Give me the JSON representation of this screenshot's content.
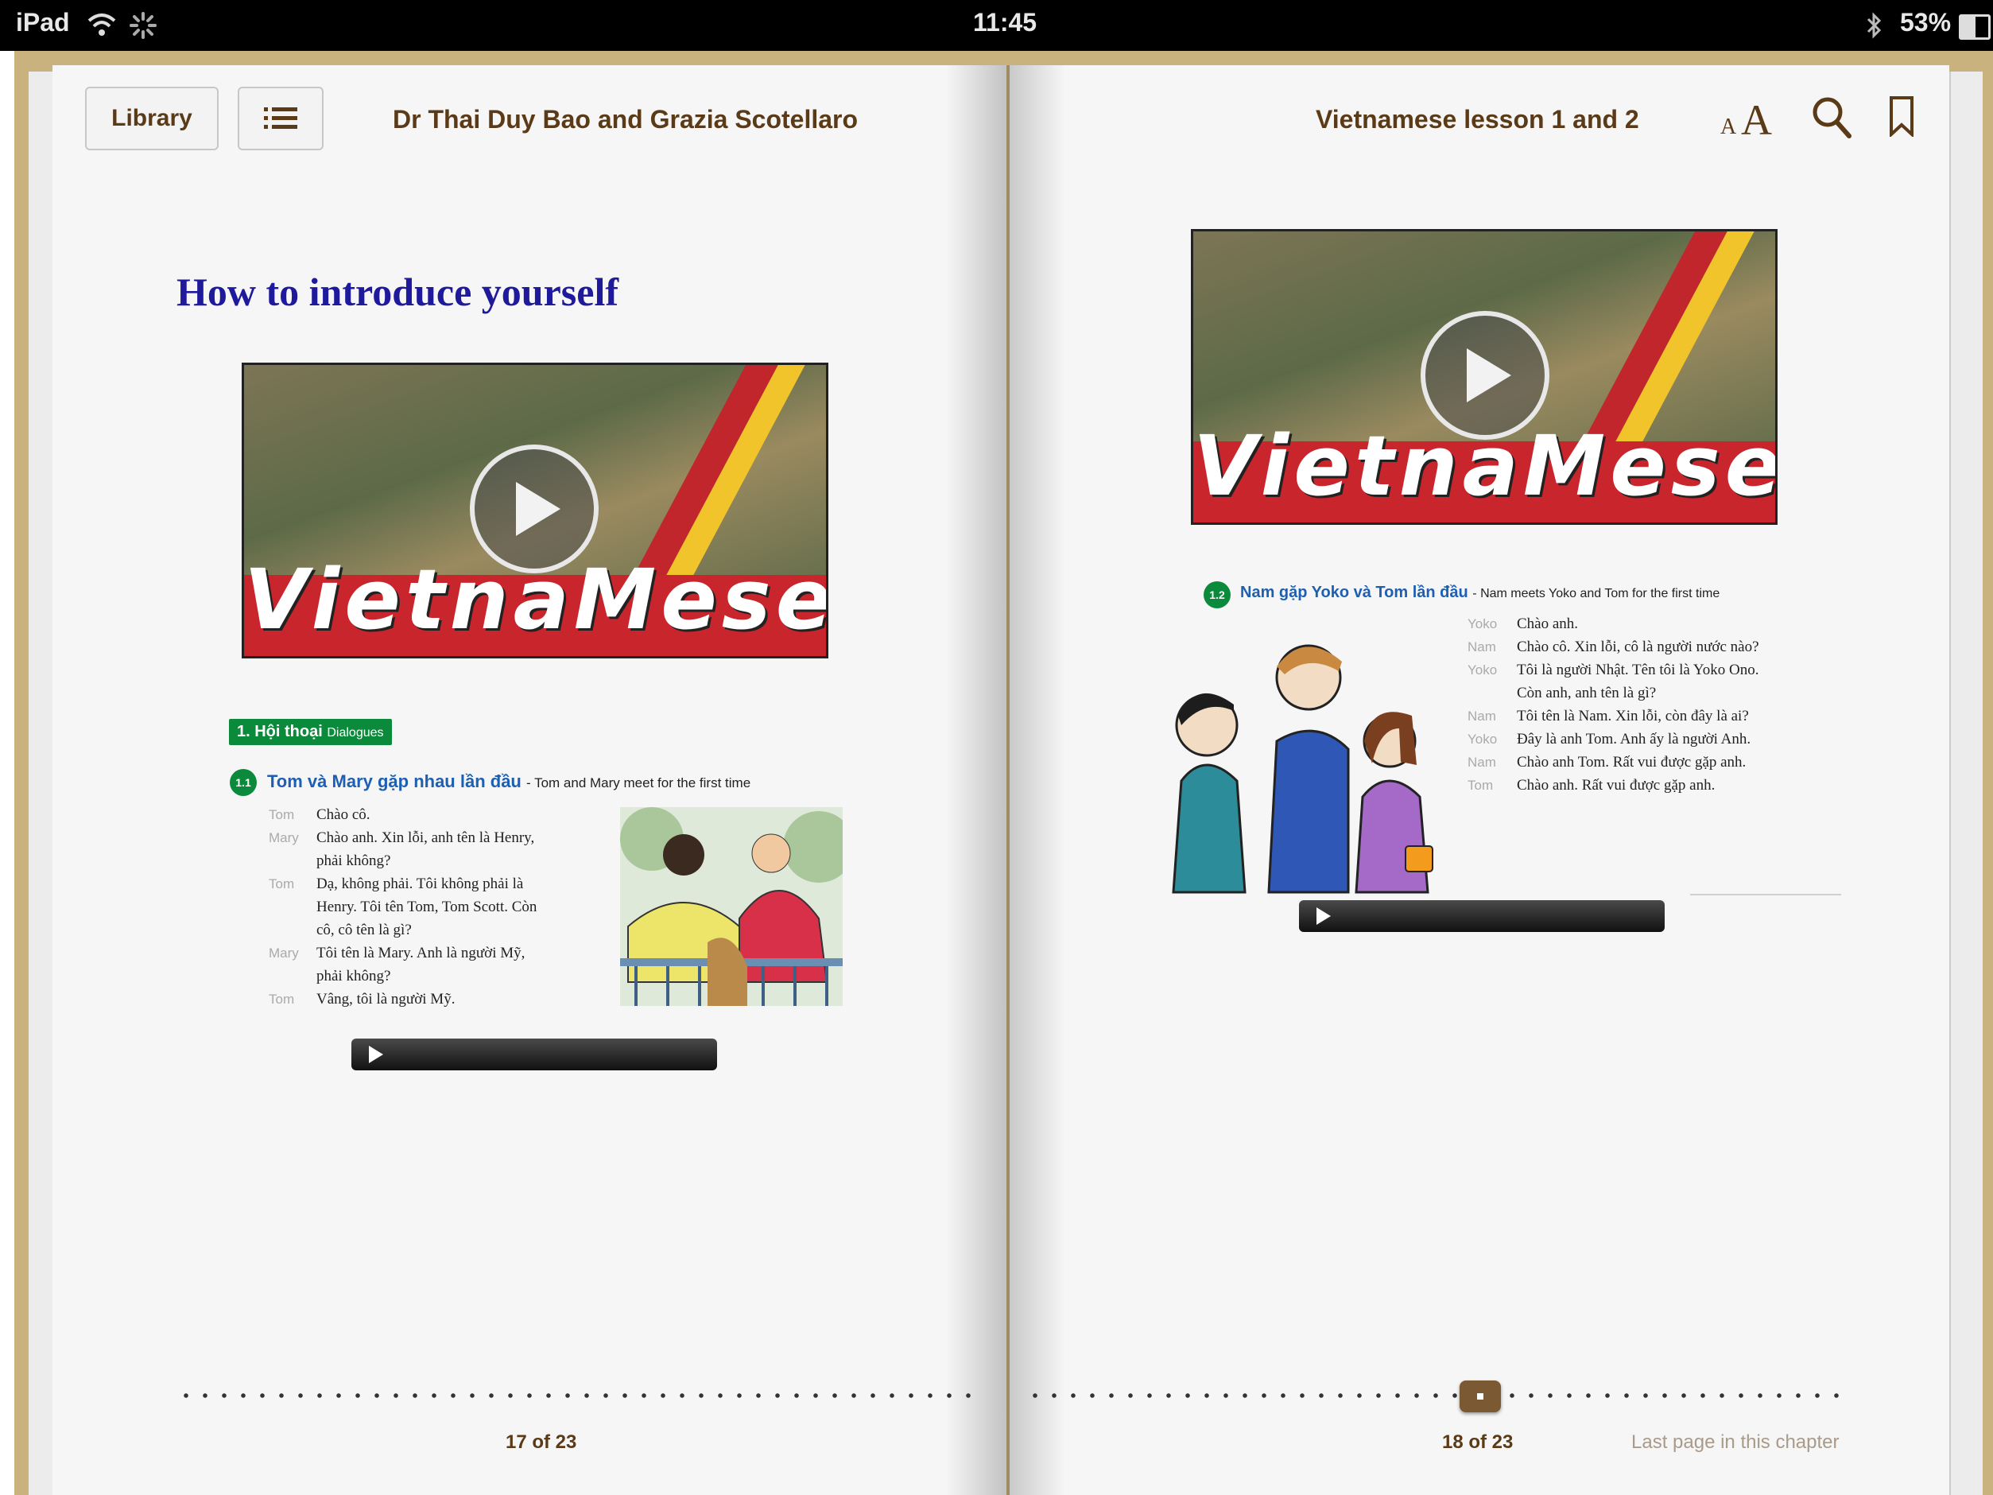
{
  "status_bar": {
    "device": "iPad",
    "time": "11:45",
    "battery": "53%",
    "icons": [
      "wifi-icon",
      "activity-spinner-icon",
      "bluetooth-icon",
      "battery-icon"
    ]
  },
  "toolbar": {
    "library_label": "Library",
    "author": "Dr Thai Duy Bao and Grazia Scotellaro",
    "title": "Vietnamese lesson 1 and 2",
    "font_size_small": "A",
    "font_size_large": "A"
  },
  "left_page": {
    "heading": "How to introduce yourself",
    "video_word": "VietnaMese",
    "section_tag": "1. Hội thoại",
    "section_tag_en": "Dialogues",
    "dialogue_number": "1.1",
    "dialogue_title": "Tom và Mary gặp nhau lần đầu",
    "dialogue_subtitle": "- Tom and Mary meet for the first time",
    "dialogue": [
      {
        "speaker": "Tom",
        "lines": [
          "Chào cô."
        ]
      },
      {
        "speaker": "Mary",
        "lines": [
          "Chào anh. Xin lỗi, anh tên là Henry,",
          "phải không?"
        ]
      },
      {
        "speaker": "Tom",
        "lines": [
          "Dạ, không phải. Tôi không phải là",
          "Henry. Tôi tên Tom, Tom Scott. Còn",
          "cô, cô tên là gì?"
        ]
      },
      {
        "speaker": "Mary",
        "lines": [
          "Tôi tên là Mary. Anh là người Mỹ,",
          "phải không?"
        ]
      },
      {
        "speaker": "Tom",
        "lines": [
          "Vâng, tôi là người Mỹ."
        ]
      }
    ],
    "page_label": "17 of 23"
  },
  "right_page": {
    "video_word": "VietnaMese",
    "dialogue_number": "1.2",
    "dialogue_title": "Nam gặp Yoko và Tom lần đầu",
    "dialogue_subtitle": "- Nam meets Yoko and Tom for the first time",
    "dialogue": [
      {
        "speaker": "Yoko",
        "lines": [
          "Chào anh."
        ]
      },
      {
        "speaker": "Nam",
        "lines": [
          "Chào cô. Xin lỗi, cô là người nước nào?"
        ]
      },
      {
        "speaker": "Yoko",
        "lines": [
          "Tôi là người Nhật. Tên tôi là Yoko Ono.",
          "Còn anh, anh tên là gì?"
        ]
      },
      {
        "speaker": "Nam",
        "lines": [
          "Tôi tên là Nam. Xin lỗi, còn đây là ai?"
        ]
      },
      {
        "speaker": "Yoko",
        "lines": [
          "Đây là anh Tom. Anh ấy là người Anh."
        ]
      },
      {
        "speaker": "Nam",
        "lines": [
          "Chào anh Tom. Rất vui được gặp anh."
        ]
      },
      {
        "speaker": "Tom",
        "lines": [
          "Chào anh. Rất vui được gặp anh."
        ]
      }
    ],
    "page_label": "18 of 23",
    "chapter_note": "Last page in this chapter"
  },
  "colors": {
    "heading": "#1f1a9c",
    "toolbar_text": "#5b3a18",
    "dialogue_title": "#1d5fb3",
    "tag_green": "#0b8a3c",
    "video_red": "#c8252c"
  }
}
